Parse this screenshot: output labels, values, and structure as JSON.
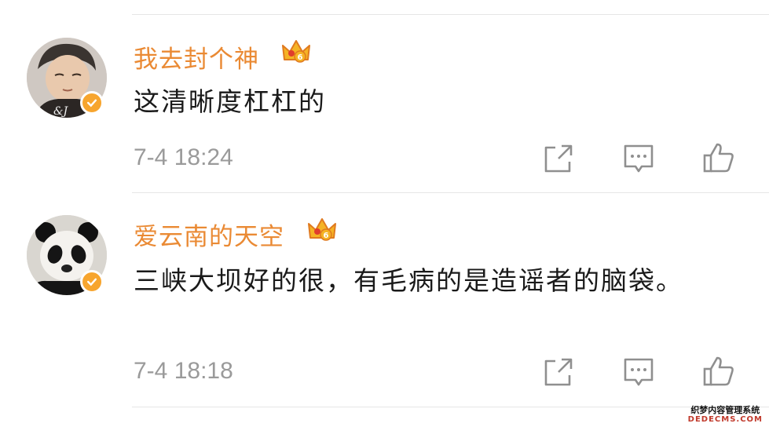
{
  "comments": [
    {
      "username": "我去封个神",
      "text": "这清晰度杠杠的",
      "time": "7-4 18:24",
      "avatar": "child-avatar",
      "badge_icon": "crown-icon",
      "badge_level": "6",
      "verified": true
    },
    {
      "username": "爱云南的天空",
      "text": "三峡大坝好的很，有毛病的是造谣者的脑袋。",
      "time": "7-4 18:18",
      "avatar": "panda-avatar",
      "badge_icon": "crown-icon",
      "badge_level": "6",
      "verified": true
    }
  ],
  "actions": [
    "share-icon",
    "comment-icon",
    "like-icon"
  ],
  "watermark": {
    "cn": "织梦内容管理系统",
    "en": "DEDECMS.COM"
  },
  "colors": {
    "username": "#ea8a34",
    "badge": "#f7a52e",
    "time": "#9a9a9a",
    "text": "#1a1a1a"
  }
}
